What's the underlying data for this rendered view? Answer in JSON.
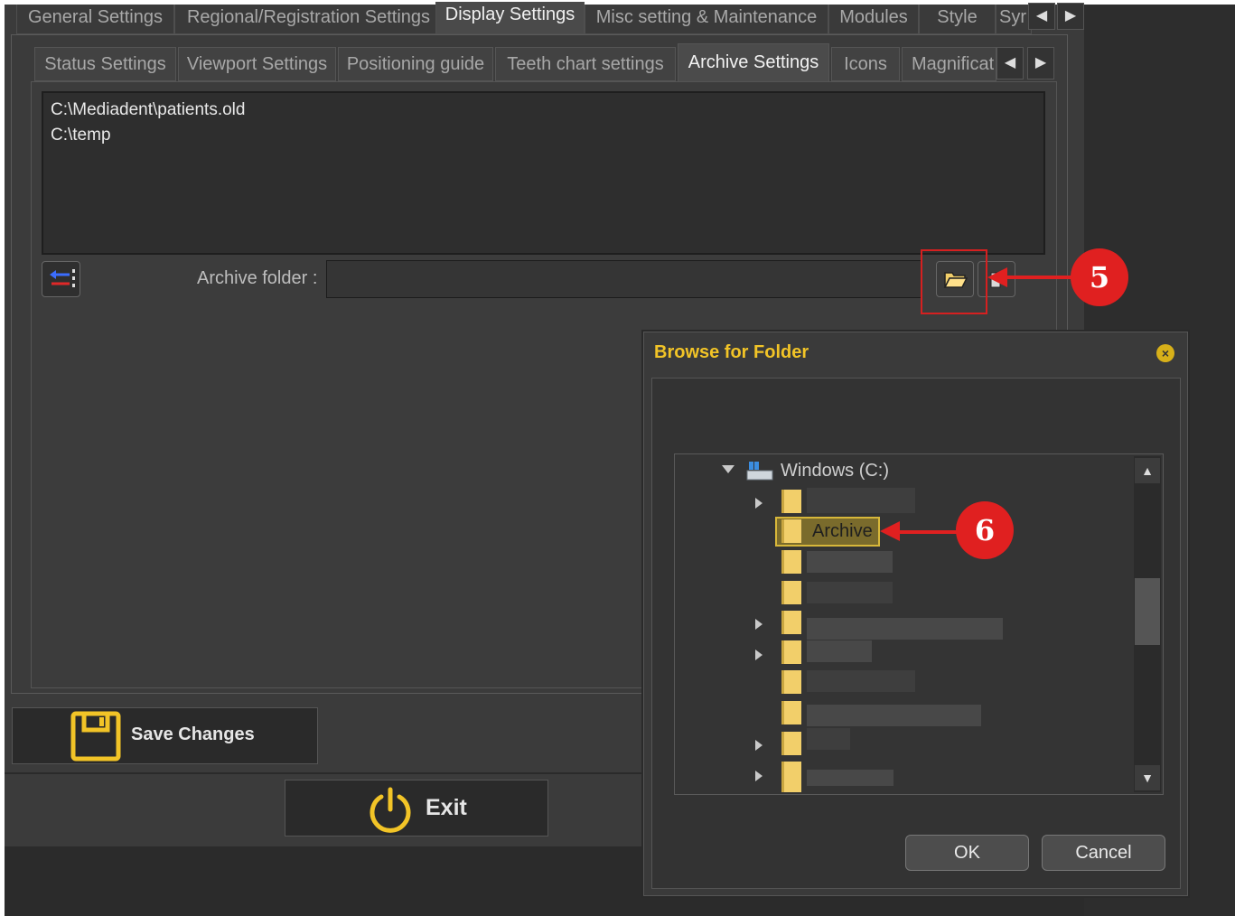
{
  "top_tabs": [
    "General Settings",
    "Regional/Registration Settings",
    "Display Settings",
    "Misc setting & Maintenance",
    "Modules",
    "Style",
    "Syr"
  ],
  "active_top_tab": "Display Settings",
  "sub_tabs": [
    "Status Settings",
    "Viewport Settings",
    "Positioning guide",
    "Teeth chart settings",
    "Archive Settings",
    "Icons",
    "Magnificat"
  ],
  "active_sub_tab": "Archive Settings",
  "archive_paths": [
    "C:\\Mediadent\\patients.old",
    "C:\\temp"
  ],
  "archive_folder_label": "Archive folder :",
  "archive_folder_value": "",
  "save_label": "Save Changes",
  "exit_label": "Exit",
  "callouts": {
    "browse": "5",
    "archive": "6"
  },
  "dialog": {
    "title": "Browse for Folder",
    "root_label": "Windows (C:)",
    "selected_folder": "Archive",
    "ok_label": "OK",
    "cancel_label": "Cancel"
  },
  "colors": {
    "accent": "#f2c427",
    "callout": "#e02020",
    "background": "#2b2b2b"
  }
}
